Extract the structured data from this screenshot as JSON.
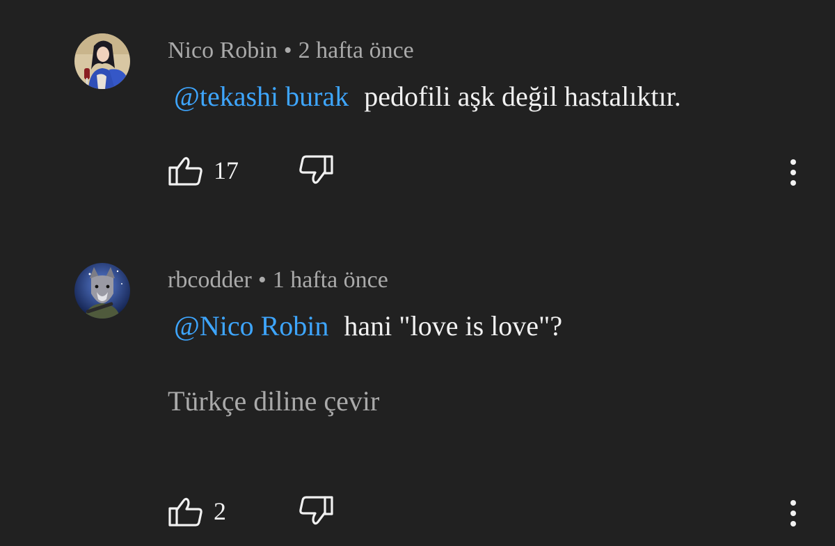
{
  "comments": [
    {
      "author": "Nico Robin",
      "separator": "•",
      "time": "2 hafta önce",
      "mention": "@tekashi burak",
      "text": "pedofili aşk değil hastalıktır.",
      "likes": "17",
      "avatar_icon": "anime-character-avatar"
    },
    {
      "author": "rbcodder",
      "separator": "•",
      "time": "1 hafta önce",
      "mention": "@Nico Robin",
      "text": "hani \"love is love\"?",
      "translate": "Türkçe diline çevir",
      "likes": "2",
      "avatar_icon": "wolf-character-avatar"
    }
  ],
  "colors": {
    "background": "#212121",
    "text_primary": "#f1f1f1",
    "text_secondary": "#aaaaaa",
    "mention": "#3ea6ff"
  }
}
